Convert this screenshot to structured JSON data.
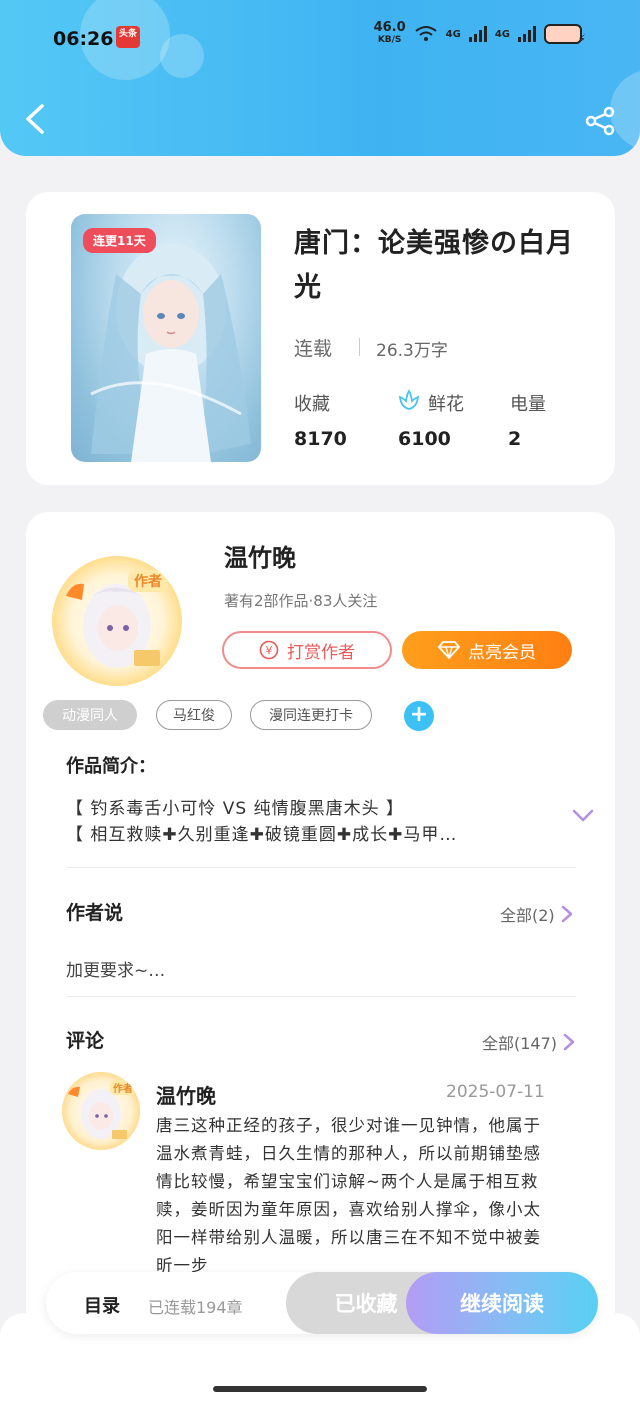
{
  "status_bar": {
    "time": "06:26",
    "app_badge": "头条",
    "net_speed": "46.0",
    "net_unit": "KB/S",
    "signal_1": "4G",
    "signal_2": "4G"
  },
  "book": {
    "cover_badge": "连更11天",
    "title": "唐门：论美强惨の白月光",
    "status": "连载",
    "word_count": "26.3万字",
    "stats": [
      {
        "label": "收藏",
        "value": "8170"
      },
      {
        "label": "鲜花",
        "value": "6100"
      },
      {
        "label": "电量",
        "value": "2"
      }
    ]
  },
  "author": {
    "avatar_badge": "作者",
    "name": "温竹晚",
    "meta": "著有2部作品·83人关注",
    "reward_label": "打赏作者",
    "member_label": "点亮会员"
  },
  "tags": [
    "动漫同人",
    "马红俊",
    "漫同连更打卡"
  ],
  "intro": {
    "title": "作品简介：",
    "line1": "【 钓系毒舌小可怜  VS  纯情腹黑唐木头 】",
    "line2": "【 相互救赎✚久别重逢✚破镜重圆✚成长✚马甲…"
  },
  "author_says": {
    "title": "作者说",
    "more": "全部(2)",
    "text": "加更要求~…"
  },
  "comments": {
    "title": "评论",
    "more": "全部(147)",
    "items": [
      {
        "name": "温竹晚",
        "date": "2025-07-11",
        "text": "唐三这种正经的孩子，很少对谁一见钟情，他属于温水煮青蛙，日久生情的那种人，所以前期铺垫感情比较慢，希望宝宝们谅解~两个人是属于相互救赎，姜昕因为童年原因，喜欢给别人撑伞，像小太阳一样带给别人温暖，所以唐三在不知不觉中被姜昕一步"
      }
    ]
  },
  "bottom_bar": {
    "catalog": "目录",
    "chapters": "已连载194章",
    "collected": "已收藏",
    "continue": "继续阅读"
  },
  "colors": {
    "header_blue": "#3fb3f2",
    "accent_orange": "#ff8f17",
    "reward_red": "#ea5a5a",
    "tag_add_blue": "#3dc1f5",
    "chevron_purple": "#b490e0"
  }
}
